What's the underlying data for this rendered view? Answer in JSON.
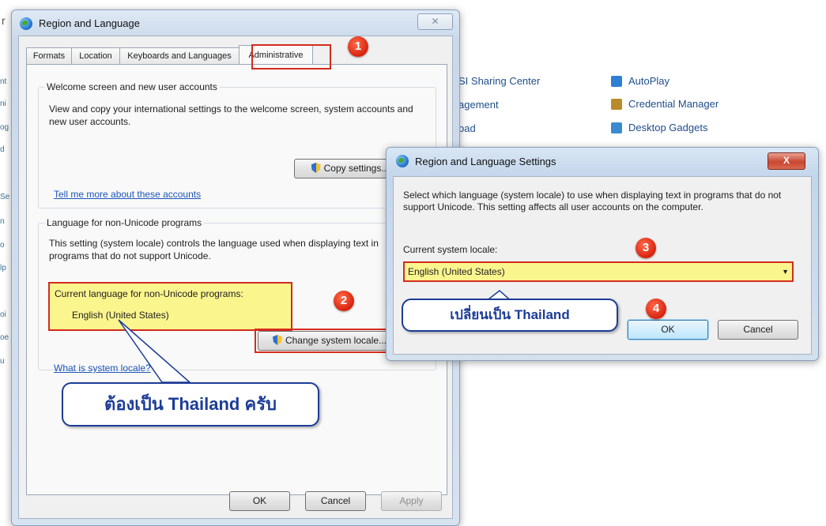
{
  "background_panel": {
    "links": [
      {
        "label": "SI Sharing Center",
        "icon": "sharing-icon"
      },
      {
        "label": "agement",
        "icon": ""
      },
      {
        "label": "bad",
        "icon": ""
      },
      {
        "label": "AutoPlay",
        "icon": "autoplay-icon",
        "color": "#2f7fd4"
      },
      {
        "label": "Credential Manager",
        "icon": "credential-icon",
        "color": "#b88a2a"
      },
      {
        "label": "Desktop Gadgets",
        "icon": "gadgets-icon",
        "color": "#3b8ad0"
      }
    ],
    "left_fragments": [
      "nt",
      "ni",
      "og",
      "d",
      "Se",
      "n",
      "o",
      "lp",
      "oi",
      "oe",
      "u"
    ],
    "top_fragment": "r"
  },
  "main_window": {
    "title": "Region and Language",
    "close_symbol": "✕",
    "tabs": [
      {
        "label": "Formats"
      },
      {
        "label": "Location"
      },
      {
        "label": "Keyboards and Languages"
      },
      {
        "label": "Administrative",
        "active": true
      }
    ],
    "welcome_group": {
      "title": "Welcome screen and new user accounts",
      "description": "View and copy your international settings to the welcome screen, system accounts and new user accounts.",
      "copy_button": "Copy settings...",
      "link": "Tell me more about these accounts"
    },
    "unicode_group": {
      "title": "Language for non-Unicode programs",
      "description": "This setting (system locale) controls the language used when displaying text in programs that do not support Unicode.",
      "current_label": "Current language for non-Unicode programs:",
      "current_value": "English (United States)",
      "change_button": "Change system locale...",
      "link": "What is system locale?"
    },
    "footer_buttons": {
      "ok": "OK",
      "cancel": "Cancel",
      "apply": "Apply"
    }
  },
  "settings_dialog": {
    "title": "Region and Language Settings",
    "close_symbol": "X",
    "description": "Select which language (system locale) to use when displaying text in programs that do not support Unicode. This setting affects all user accounts on the computer.",
    "locale_label": "Current system locale:",
    "locale_value": "English (United States)",
    "ok": "OK",
    "cancel": "Cancel"
  },
  "annotations": {
    "badges": [
      "1",
      "2",
      "3",
      "4"
    ],
    "callout_change": "เปลี่ยนเป็น Thailand",
    "callout_must": "ต้องเป็น Thailand ครับ",
    "highlight_color": "#fbf58e",
    "border_color": "#d42b1d",
    "callout_color": "#1c3c96"
  }
}
